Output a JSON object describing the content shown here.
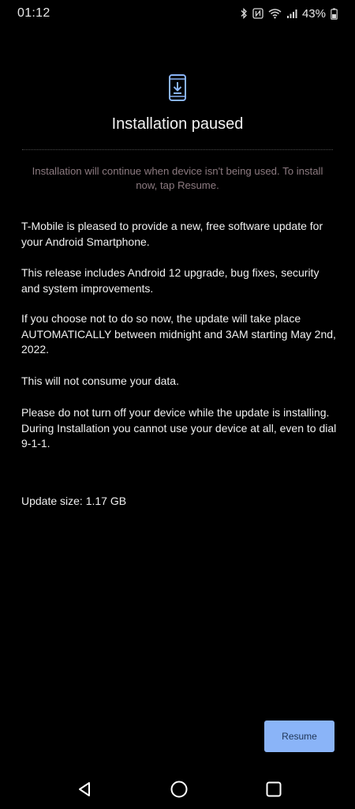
{
  "status_bar": {
    "time": "01:12",
    "battery_percent": "43%",
    "icons": [
      "bluetooth-icon",
      "nfc-icon",
      "wifi-icon",
      "signal-icon",
      "battery-icon"
    ]
  },
  "header": {
    "icon": "phone-download-icon",
    "title": "Installation paused",
    "accent_color": "#8ab4f8"
  },
  "notice": {
    "text": "Installation will continue when device isn't being used. To install now, tap Resume.",
    "color": "#8c7a80"
  },
  "body": {
    "paragraphs": [
      "T-Mobile is pleased to provide a new, free software update for your Android Smartphone.",
      "This release includes Android 12 upgrade, bug fixes, security and system improvements.",
      "If you choose not to do so now, the update will take place AUTOMATICALLY between midnight and 3AM starting May 2nd, 2022.",
      "This will not consume your data.",
      "Please do not turn off your device while the update is installing. During Installation you cannot use your device at all, even to dial 9-1-1."
    ],
    "update_size": "Update size: 1.17 GB"
  },
  "actions": {
    "resume_label": "Resume",
    "button_color": "#8ab4f8"
  },
  "nav_bar": {
    "icons": [
      "back-icon",
      "home-icon",
      "recents-icon"
    ]
  }
}
